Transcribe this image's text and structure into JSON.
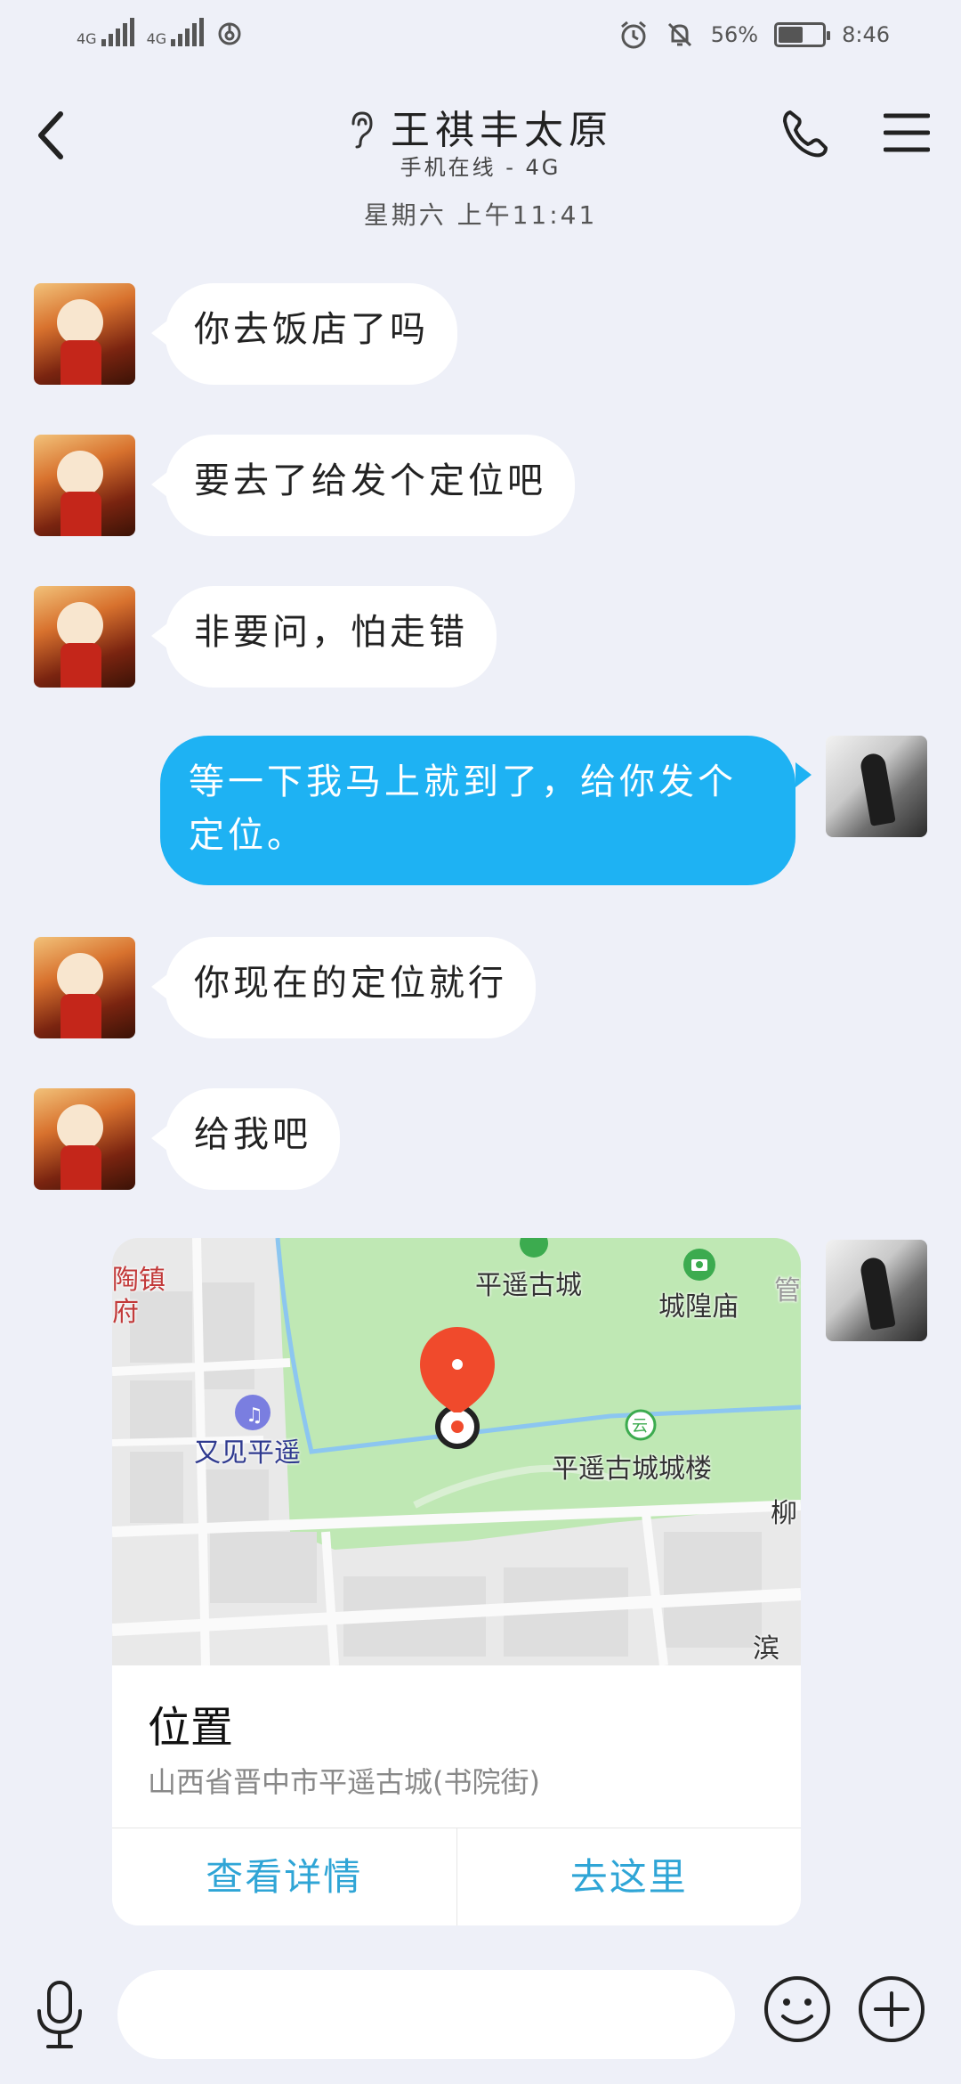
{
  "status_bar": {
    "sim1_label": "4G",
    "sim2_label": "4G",
    "battery_percent_text": "56%",
    "battery_level": 0.56,
    "time": "8:46"
  },
  "header": {
    "title": "王祺丰太原",
    "subtitle": "手机在线 - 4G",
    "timestamp": "星期六 上午11:41"
  },
  "messages": [
    {
      "direction": "in",
      "text": "你去饭店了吗"
    },
    {
      "direction": "in",
      "text": "要去了给发个定位吧"
    },
    {
      "direction": "in",
      "text": "非要问，怕走错"
    },
    {
      "direction": "out",
      "text": "等一下我马上就到了，给你发个定位。"
    },
    {
      "direction": "in",
      "text": "你现在的定位就行"
    },
    {
      "direction": "in",
      "text": "给我吧"
    }
  ],
  "location_card": {
    "map_labels": {
      "taozhen": "陶镇府",
      "ancient_city": "平遥古城",
      "temple": "城隍庙",
      "youjian": "又见平遥",
      "gate_tower": "平遥古城城楼",
      "liu": "柳",
      "bin": "滨",
      "edge": "管"
    },
    "title": "位置",
    "address": "山西省晋中市平遥古城(书院街)",
    "actions": {
      "details": "查看详情",
      "go": "去这里"
    }
  },
  "input_bar": {
    "placeholder": ""
  },
  "colors": {
    "outgoing_bubble": "#1eb2f3",
    "incoming_bubble": "#ffffff",
    "action_text": "#2fa5d6",
    "map_green": "#bfe8b4",
    "pin_red": "#f04a2c"
  }
}
